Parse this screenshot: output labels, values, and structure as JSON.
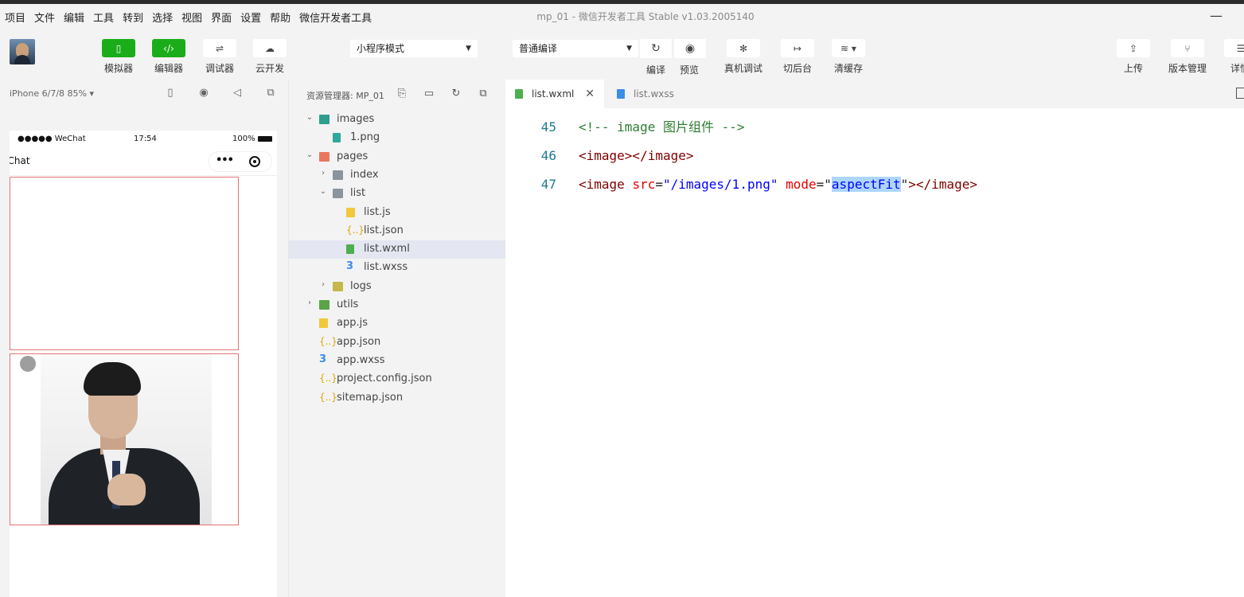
{
  "menu": [
    "项目",
    "文件",
    "编辑",
    "工具",
    "转到",
    "选择",
    "视图",
    "界面",
    "设置",
    "帮助",
    "微信开发者工具"
  ],
  "window": {
    "title": "mp_01 - 微信开发者工具 Stable v1.03.2005140",
    "minimize": "—"
  },
  "toolbar": {
    "simulator": "模拟器",
    "editor": "编辑器",
    "debugger": "调试器",
    "cloud": "云开发",
    "mode_select": "小程序模式",
    "compile_select": "普通编译",
    "compile": "编译",
    "preview": "预览",
    "real_debug": "真机调试",
    "background": "切后台",
    "clear_cache": "清缓存",
    "upload": "上传",
    "version": "版本管理",
    "details": "详情"
  },
  "simulator": {
    "device": "iPhone 6/7/8 85% ▾",
    "status_left": "●●●●● WeChat",
    "status_time": "17:54",
    "status_right": "100%",
    "nav_title": "WeChat"
  },
  "explorer": {
    "title": "资源管理器: MP_01",
    "tree": [
      {
        "name": "images",
        "type": "folder-img",
        "depth": 0,
        "chev": "⌄"
      },
      {
        "name": "1.png",
        "type": "png",
        "depth": 1,
        "chev": ""
      },
      {
        "name": "pages",
        "type": "folder-pages",
        "depth": 0,
        "chev": "⌄"
      },
      {
        "name": "index",
        "type": "folder",
        "depth": 1,
        "chev": "›"
      },
      {
        "name": "list",
        "type": "folder",
        "depth": 1,
        "chev": "⌄"
      },
      {
        "name": "list.js",
        "type": "js",
        "depth": 2,
        "chev": ""
      },
      {
        "name": "list.json",
        "type": "json",
        "depth": 2,
        "chev": ""
      },
      {
        "name": "list.wxml",
        "type": "wxml",
        "depth": 2,
        "chev": "",
        "selected": true
      },
      {
        "name": "list.wxss",
        "type": "wxss",
        "depth": 2,
        "chev": ""
      },
      {
        "name": "logs",
        "type": "folder-logs",
        "depth": 1,
        "chev": "›"
      },
      {
        "name": "utils",
        "type": "folder-utils",
        "depth": 0,
        "chev": "›"
      },
      {
        "name": "app.js",
        "type": "js",
        "depth": 0,
        "chev": ""
      },
      {
        "name": "app.json",
        "type": "json",
        "depth": 0,
        "chev": ""
      },
      {
        "name": "app.wxss",
        "type": "wxss",
        "depth": 0,
        "chev": ""
      },
      {
        "name": "project.config.json",
        "type": "json",
        "depth": 0,
        "chev": ""
      },
      {
        "name": "sitemap.json",
        "type": "json",
        "depth": 0,
        "chev": ""
      }
    ]
  },
  "editor": {
    "tabs": [
      {
        "name": "list.wxml",
        "active": true,
        "close": "✕",
        "color": "#4caf50"
      },
      {
        "name": "list.wxss",
        "active": false,
        "close": "",
        "color": "#3a8ee6"
      }
    ],
    "lines": [
      {
        "num": "45",
        "tokens": [
          {
            "t": "<!-- image 图片组件 -->",
            "c": "cm"
          }
        ]
      },
      {
        "num": "46",
        "tokens": [
          {
            "t": "<image></image>",
            "c": "tg"
          }
        ]
      },
      {
        "num": "47",
        "tokens": [
          {
            "t": "<image ",
            "c": "tg"
          },
          {
            "t": "src",
            "c": "at"
          },
          {
            "t": "=",
            "c": "pl"
          },
          {
            "t": "\"/images/1.png\"",
            "c": "vl"
          },
          {
            "t": " ",
            "c": "pl"
          },
          {
            "t": "mode",
            "c": "at"
          },
          {
            "t": "=\"",
            "c": "pl"
          },
          {
            "t": "aspectFit",
            "c": "vl hl"
          },
          {
            "t": "\"",
            "c": "pl"
          },
          {
            "t": "></image>",
            "c": "tg"
          }
        ]
      }
    ]
  }
}
